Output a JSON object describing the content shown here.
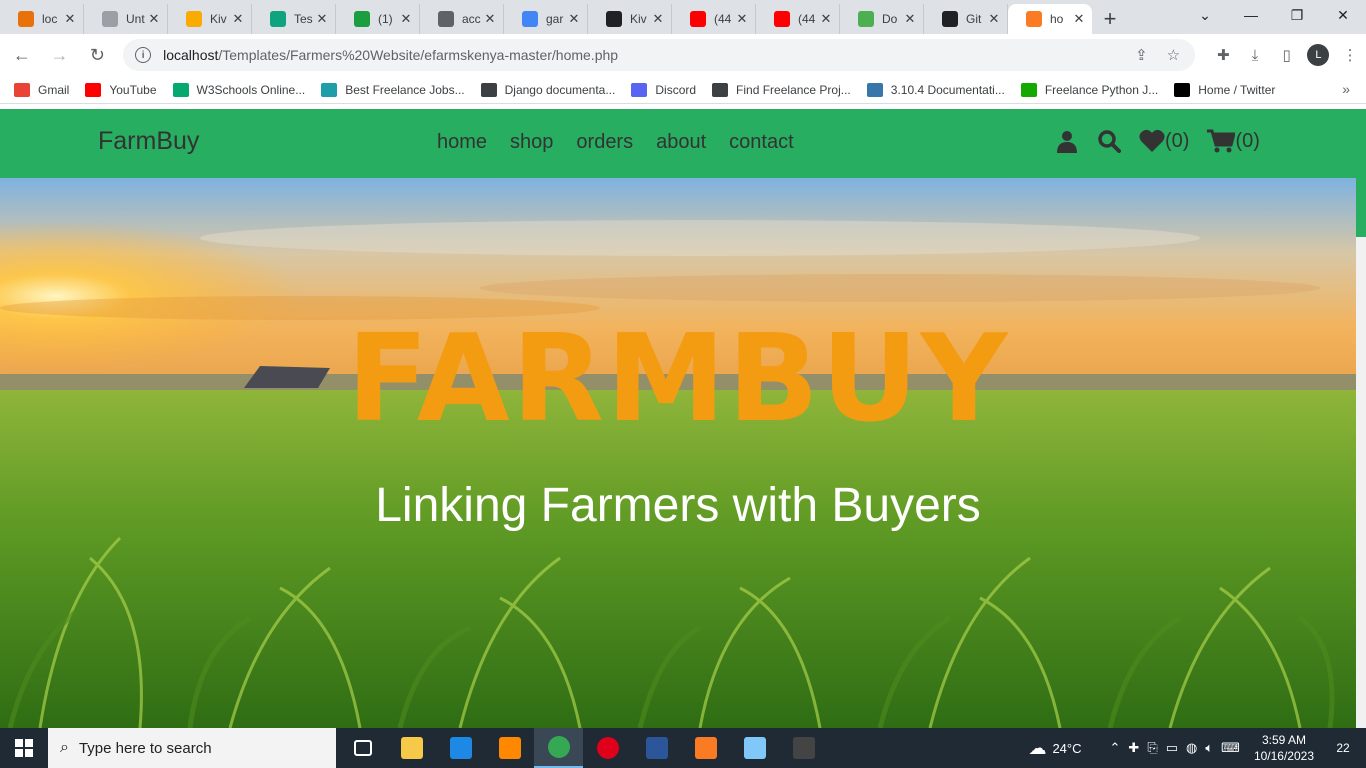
{
  "browser": {
    "tabs": [
      {
        "title": "loc",
        "favicon": "vlc-like-icon",
        "color": "#e8710a"
      },
      {
        "title": "Unt",
        "favicon": "colab-icon",
        "color": "#9aa0a6"
      },
      {
        "title": "Kiv",
        "favicon": "colab-icon",
        "color": "#f9ab00"
      },
      {
        "title": "Tes",
        "favicon": "chatgpt-icon",
        "color": "#10a37f"
      },
      {
        "title": "(1)",
        "favicon": "notification-icon",
        "color": "#1a9e3f"
      },
      {
        "title": "acc",
        "favicon": "globe-icon",
        "color": "#5f6368"
      },
      {
        "title": "gar",
        "favicon": "google-icon",
        "color": "#4285f4"
      },
      {
        "title": "Kiv",
        "favicon": "kivy-icon",
        "color": "#202124"
      },
      {
        "title": "(44",
        "favicon": "youtube-icon",
        "color": "#ff0000"
      },
      {
        "title": "(44",
        "favicon": "youtube-icon",
        "color": "#ff0000"
      },
      {
        "title": "Do",
        "favicon": "download-icon",
        "color": "#4caf50"
      },
      {
        "title": "Git",
        "favicon": "github-icon",
        "color": "#202124"
      },
      {
        "title": "ho",
        "favicon": "xampp-icon",
        "color": "#fb7a24",
        "active": true
      }
    ],
    "url_host": "localhost",
    "url_path": "/Templates/Farmers%20Website/efarmskenya-master/home.php",
    "profile_initial": "L",
    "bookmarks": [
      {
        "label": "Gmail",
        "icon": "gmail-icon",
        "color": "#ea4335"
      },
      {
        "label": "YouTube",
        "icon": "youtube-icon",
        "color": "#ff0000"
      },
      {
        "label": "W3Schools Online...",
        "icon": "w3schools-icon",
        "color": "#04aa6d"
      },
      {
        "label": "Best Freelance Jobs...",
        "icon": "freelance-icon",
        "color": "#1f9eaa"
      },
      {
        "label": "Django documenta...",
        "icon": "django-icon",
        "color": "#3c4043"
      },
      {
        "label": "Discord",
        "icon": "discord-icon",
        "color": "#5865f2"
      },
      {
        "label": "Find Freelance Proj...",
        "icon": "tools-icon",
        "color": "#3c4043"
      },
      {
        "label": "3.10.4 Documentati...",
        "icon": "python-icon",
        "color": "#3776ab"
      },
      {
        "label": "Freelance Python J...",
        "icon": "upwork-icon",
        "color": "#14a800"
      },
      {
        "label": "Home / Twitter",
        "icon": "x-icon",
        "color": "#000000"
      }
    ]
  },
  "site": {
    "logo": "FarmBuy",
    "nav": [
      "home",
      "shop",
      "orders",
      "about",
      "contact"
    ],
    "wishlist_count": "(0)",
    "cart_count": "(0)",
    "hero_title": "FARMBUY",
    "hero_subtitle": "Linking Farmers with Buyers",
    "colors": {
      "header": "#27ae60",
      "title": "#f39c12",
      "text": "#333333"
    }
  },
  "taskbar": {
    "search_placeholder": "Type here to search",
    "temperature": "24°C",
    "time": "3:59 AM",
    "date": "10/16/2023",
    "notifications": "22",
    "apps": [
      {
        "name": "task-view",
        "color": "#ffffff"
      },
      {
        "name": "file-explorer",
        "color": "#f7c948"
      },
      {
        "name": "vscode",
        "color": "#1e88e5"
      },
      {
        "name": "vlc",
        "color": "#ff8800"
      },
      {
        "name": "chrome",
        "color": "#34a853",
        "active": true
      },
      {
        "name": "opera",
        "color": "#e0001b"
      },
      {
        "name": "word",
        "color": "#2b579a"
      },
      {
        "name": "xampp",
        "color": "#fb7a24"
      },
      {
        "name": "notepad-app",
        "color": "#7fc8f8"
      },
      {
        "name": "terminal",
        "color": "#444444"
      }
    ]
  }
}
